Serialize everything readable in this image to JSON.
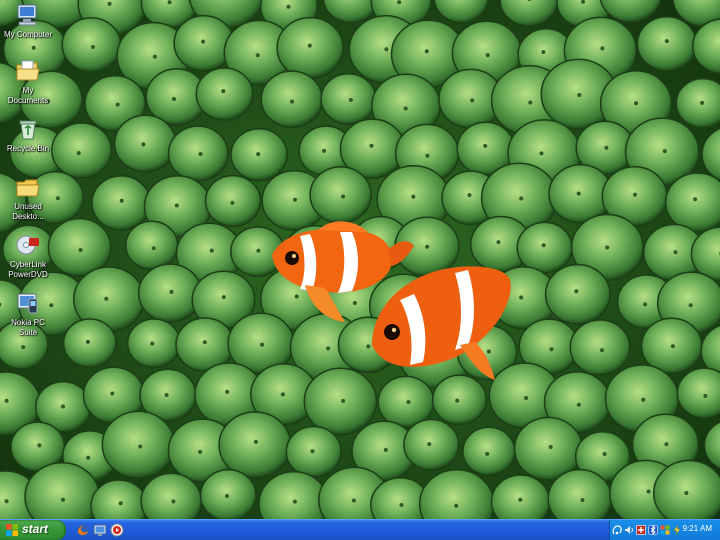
{
  "desktop": {
    "icons": [
      {
        "label": "My Computer"
      },
      {
        "label": "My Documents"
      },
      {
        "label": "Recycle Bin"
      },
      {
        "label": "Unused Deskto..."
      },
      {
        "label": "CyberLink PowerDVD"
      },
      {
        "label": "Nokia PC Suite"
      }
    ]
  },
  "taskbar": {
    "start_label": "start",
    "quick_launch": [
      "firefox-icon",
      "show-desktop-icon",
      "media-player-icon"
    ],
    "tray_icons": [
      "network-icon",
      "volume-icon",
      "antivirus-icon",
      "bluetooth-icon",
      "security-icon",
      "power-icon"
    ],
    "clock": "9:21 AM"
  },
  "colors": {
    "taskbar_blue": "#245edb",
    "start_green": "#3c9a3c",
    "tray_blue": "#0f7ad8",
    "anemone_green": "#5aa05a",
    "clownfish_orange": "#ff6a10"
  }
}
